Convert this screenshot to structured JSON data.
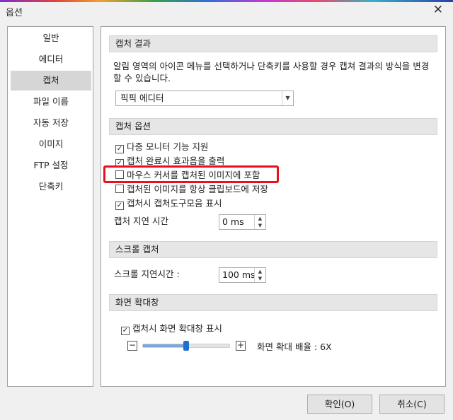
{
  "window": {
    "title": "옵션",
    "close_glyph": "✕"
  },
  "sidebar": {
    "items": [
      {
        "label": "일반"
      },
      {
        "label": "에디터"
      },
      {
        "label": "캡처",
        "selected": true
      },
      {
        "label": "파일 이름"
      },
      {
        "label": "자동 저장"
      },
      {
        "label": "이미지"
      },
      {
        "label": "FTP 설정"
      },
      {
        "label": "단축키"
      }
    ]
  },
  "capture_result": {
    "header": "캡처 결과",
    "description_line1": "알림 영역의 아이콘 메뉴를 선택하거나 단축키를 사용할 경우 캡쳐 결과의 방식을 변경",
    "description_line2": "할 수 있습니다.",
    "select_value": "픽픽 에디터"
  },
  "capture_options": {
    "header": "캡처 옵션",
    "checkboxes": [
      {
        "label": "다중 모니터 기능 지원",
        "checked": true
      },
      {
        "label": "캡처 완료시 효과음을 출력",
        "checked": true
      },
      {
        "label": "마우스 커서를 캡처된 이미지에 포함",
        "checked": false,
        "highlighted": true
      },
      {
        "label": "캡처된 이미지를 항상 클립보드에 저장",
        "checked": false
      },
      {
        "label": "캡처시 캡처도구모음 표시",
        "checked": true
      }
    ],
    "delay_label": "캡처 지연 시간",
    "delay_value": "0 ms"
  },
  "scroll_capture": {
    "header": "스크롤 캡처",
    "delay_label": "스크롤 지연시간 :",
    "delay_value": "100 ms"
  },
  "magnifier": {
    "header": "화면 확대창",
    "show_label": "캡처시 화면 확대창 표시",
    "show_checked": true,
    "minus": "−",
    "plus": "+",
    "zoom_label": "화면 확대 배율 : 6X",
    "slider_level": 0.5
  },
  "footer": {
    "ok_label": "확인(O)",
    "cancel_label": "취소(C)"
  },
  "colors": {
    "highlight": "#e8101a",
    "slider_thumb": "#1f6fd0",
    "selected_bg": "#d6d6d6"
  }
}
